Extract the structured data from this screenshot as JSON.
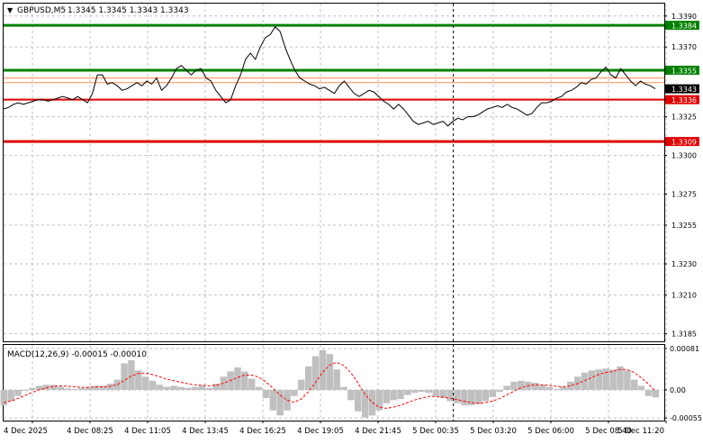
{
  "header": {
    "symbol_label": "GBPUSD,M5",
    "ohlc_label": "1.3345 1.3345 1.3343 1.3343"
  },
  "colors": {
    "background": "#ffffff",
    "grid": "#c0c0c0",
    "price_line": "#000000",
    "green_level": "#008000",
    "red_level": "#e00000",
    "orange_level": "#ff8c50",
    "macd_hist": "#c0c0c0",
    "macd_signal": "#ff0000",
    "vline": "#000000"
  },
  "chart_data": [
    {
      "type": "line",
      "name": "price",
      "grid": true,
      "ylim": [
        1.318,
        1.3398
      ],
      "y_ticks": [
        {
          "value": 1.339,
          "label": "1.3390"
        },
        {
          "value": 1.337,
          "label": "1.3370"
        },
        {
          "value": 1.3325,
          "label": "1.3325"
        },
        {
          "value": 1.33,
          "label": "1.3300"
        },
        {
          "value": 1.3275,
          "label": "1.3275"
        },
        {
          "value": 1.3255,
          "label": "1.3255"
        },
        {
          "value": 1.323,
          "label": "1.3230"
        },
        {
          "value": 1.321,
          "label": "1.3210"
        },
        {
          "value": 1.3185,
          "label": "1.3185"
        }
      ],
      "x_ticks": [
        "4 Dec 2025",
        "4 Dec 08:25",
        "4 Dec 11:05",
        "4 Dec 13:45",
        "4 Dec 16:25",
        "4 Dec 19:05",
        "4 Dec 21:45",
        "5 Dec 00:35",
        "5 Dec 03:20",
        "5 Dec 06:00",
        "5 Dec 08:40",
        "5 Dec 11:20"
      ],
      "levels": [
        {
          "value": 1.3384,
          "label": "1.3384",
          "color": "green"
        },
        {
          "value": 1.3355,
          "label": "1.3355",
          "color": "green"
        },
        {
          "value": 1.335,
          "label": "",
          "color": "orange"
        },
        {
          "value": 1.3347,
          "label": "",
          "color": "orange"
        },
        {
          "value": 1.3336,
          "label": "1.3336",
          "color": "red"
        },
        {
          "value": 1.3309,
          "label": "1.3309",
          "color": "red"
        }
      ],
      "current_price": {
        "value": 1.3343,
        "label": "1.3343"
      },
      "values": [
        1.333,
        1.3331,
        1.3333,
        1.3334,
        1.3333,
        1.3334,
        1.3335,
        1.3336,
        1.3336,
        1.3335,
        1.3336,
        1.3337,
        1.3338,
        1.3337,
        1.3336,
        1.3338,
        1.3336,
        1.3334,
        1.334,
        1.3352,
        1.3352,
        1.3346,
        1.3347,
        1.3345,
        1.3342,
        1.3343,
        1.3345,
        1.3347,
        1.3345,
        1.3348,
        1.3346,
        1.335,
        1.3342,
        1.3345,
        1.335,
        1.3356,
        1.3358,
        1.3355,
        1.3352,
        1.3355,
        1.3356,
        1.335,
        1.3348,
        1.3342,
        1.3338,
        1.3334,
        1.3336,
        1.3345,
        1.3352,
        1.3362,
        1.3366,
        1.3362,
        1.337,
        1.3376,
        1.3378,
        1.3383,
        1.338,
        1.337,
        1.3362,
        1.3355,
        1.335,
        1.3348,
        1.3346,
        1.3345,
        1.3343,
        1.3344,
        1.3342,
        1.334,
        1.3345,
        1.3348,
        1.3344,
        1.334,
        1.3338,
        1.334,
        1.3342,
        1.3341,
        1.3338,
        1.3335,
        1.3333,
        1.333,
        1.3333,
        1.333,
        1.3326,
        1.3322,
        1.332,
        1.3321,
        1.3322,
        1.332,
        1.3321,
        1.3322,
        1.3319,
        1.3322,
        1.3324,
        1.3323,
        1.3325,
        1.3325,
        1.3326,
        1.3328,
        1.333,
        1.3331,
        1.3332,
        1.3331,
        1.3333,
        1.3331,
        1.333,
        1.3328,
        1.3326,
        1.3327,
        1.3331,
        1.3334,
        1.3334,
        1.3335,
        1.3337,
        1.3338,
        1.3341,
        1.3342,
        1.3344,
        1.3347,
        1.3346,
        1.3349,
        1.335,
        1.3354,
        1.3357,
        1.3352,
        1.335,
        1.3356,
        1.3352,
        1.3348,
        1.3345,
        1.3348,
        1.3346,
        1.3345,
        1.3343
      ],
      "cursor_x_index": 90
    },
    {
      "type": "bar",
      "name": "macd",
      "title": "MACD(12,26,9) -0.00015 -0.00010",
      "ylim": [
        -0.0006,
        0.00088
      ],
      "y_ticks": [
        {
          "value": 0.00081,
          "label": "0.00081"
        },
        {
          "value": 0.0,
          "label": "0.00"
        },
        {
          "value": -0.00055,
          "label": "-0.00055"
        }
      ],
      "values": [
        -0.0003,
        -0.00022,
        -0.00012,
        -2e-05,
        4e-05,
        8e-05,
        0.0001,
        0.0001,
        6e-05,
        3e-05,
        2e-05,
        4e-05,
        6e-05,
        8e-05,
        8e-05,
        0.00012,
        0.0002,
        0.00052,
        0.00058,
        0.00038,
        0.00026,
        0.00018,
        0.0001,
        6e-05,
        8e-05,
        6e-05,
        4e-05,
        6e-05,
        8e-05,
        4e-05,
        0.00012,
        0.00026,
        0.00036,
        0.00044,
        0.00036,
        0.00022,
        6e-05,
        -0.00016,
        -0.0004,
        -0.0005,
        -0.0004,
        -0.00012,
        0.0002,
        0.00046,
        0.00066,
        0.00078,
        0.0007,
        0.0004,
        6e-05,
        -0.0002,
        -0.00042,
        -0.00054,
        -0.0005,
        -0.0004,
        -0.00026,
        -0.0002,
        -0.00018,
        -0.0001,
        -6e-05,
        -4e-05,
        -6e-05,
        -0.00012,
        -0.00016,
        -0.00022,
        -0.00026,
        -0.0003,
        -0.0003,
        -0.00028,
        -0.00022,
        -0.00014,
        -4e-05,
        8e-05,
        0.00016,
        0.00018,
        0.00016,
        0.00014,
        0.0001,
        6e-05,
        2e-05,
        6e-05,
        0.00016,
        0.00026,
        0.00034,
        0.00038,
        0.0004,
        0.00042,
        0.0004,
        0.00046,
        0.00038,
        0.0002,
        8e-05,
        -0.00012,
        -0.00015
      ],
      "signal": [
        -0.00025,
        -0.00022,
        -0.00017,
        -0.00011,
        -5e-05,
        0.0,
        4e-05,
        7e-05,
        8e-05,
        7e-05,
        6e-05,
        5e-05,
        5e-05,
        6e-05,
        6e-05,
        7e-05,
        0.0001,
        0.00018,
        0.00027,
        0.00032,
        0.00033,
        0.0003,
        0.00026,
        0.00021,
        0.00018,
        0.00015,
        0.00012,
        0.0001,
        9e-05,
        8e-05,
        9e-05,
        0.00013,
        0.00018,
        0.00024,
        0.00029,
        0.00029,
        0.00025,
        0.00016,
        4e-05,
        -0.0001,
        -0.0002,
        -0.00024,
        -0.00018,
        -4e-05,
        0.00014,
        0.00034,
        0.00048,
        0.00054,
        0.00048,
        0.00034,
        0.00014,
        -8e-05,
        -0.00024,
        -0.00034,
        -0.00036,
        -0.00034,
        -0.0003,
        -0.00025,
        -0.0002,
        -0.00016,
        -0.00013,
        -0.00013,
        -0.00014,
        -0.00016,
        -0.00019,
        -0.00022,
        -0.00025,
        -0.00026,
        -0.00025,
        -0.00022,
        -0.00017,
        -0.0001,
        -3e-05,
        4e-05,
        8e-05,
        0.0001,
        0.0001,
        9e-05,
        7e-05,
        6e-05,
        8e-05,
        0.00012,
        0.00018,
        0.00024,
        0.0003,
        0.00034,
        0.00036,
        0.0004,
        0.0004,
        0.00034,
        0.00024,
        0.00012,
        -2e-05
      ]
    }
  ]
}
